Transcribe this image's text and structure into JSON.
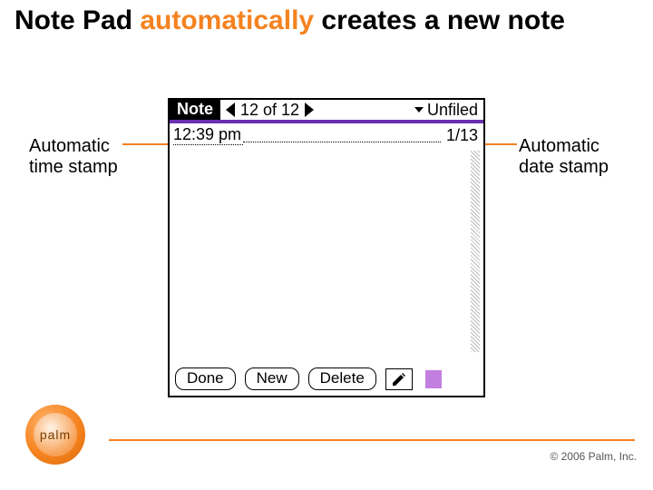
{
  "slide": {
    "title_pre": "Note Pad ",
    "title_accent": "automatically",
    "title_post": " creates a new note"
  },
  "device": {
    "app_name": "Note",
    "counter": "12 of 12",
    "category": "Unfiled",
    "time_stamp": "12:39 pm",
    "date_stamp": "1/13"
  },
  "buttons": {
    "done": "Done",
    "new": "New",
    "delete": "Delete"
  },
  "annotations": {
    "left_line1": "Automatic",
    "left_line2": "time stamp",
    "right_line1": "Automatic",
    "right_line2": "date stamp"
  },
  "footer": {
    "logo_text": "palm",
    "copyright": "© 2006 Palm, Inc."
  }
}
